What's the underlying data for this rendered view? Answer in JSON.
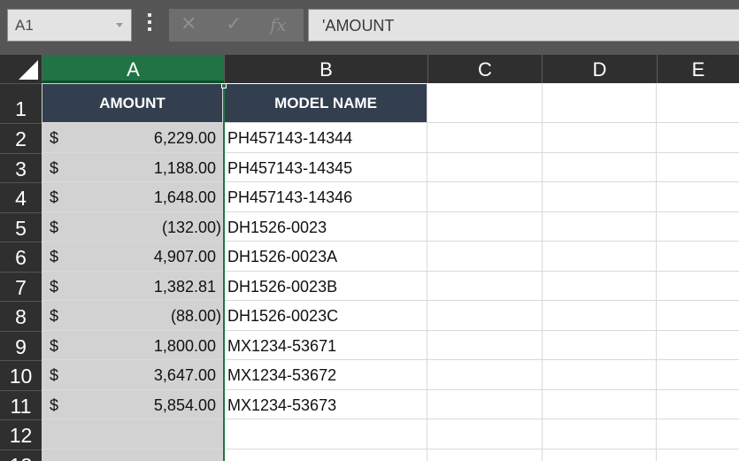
{
  "name_box": {
    "value": "A1"
  },
  "formula_bar": {
    "cancel_icon": "✕",
    "enter_icon": "✓",
    "fx_icon": "fx",
    "content": "'AMOUNT"
  },
  "columns": [
    "A",
    "B",
    "C",
    "D",
    "E"
  ],
  "rows": [
    "1",
    "2",
    "3",
    "4",
    "5",
    "6",
    "7",
    "8",
    "9",
    "10",
    "11",
    "12",
    "13"
  ],
  "table": {
    "headers": {
      "amount": "AMOUNT",
      "model": "MODEL NAME"
    },
    "currency_symbol": "$",
    "rows": [
      {
        "amount": "6,229.00",
        "model": "PH457143-14344"
      },
      {
        "amount": "1,188.00",
        "model": "PH457143-14345"
      },
      {
        "amount": "1,648.00",
        "model": "PH457143-14346"
      },
      {
        "amount": "(132.00)",
        "model": "DH1526-0023"
      },
      {
        "amount": "4,907.00",
        "model": "DH1526-0023A"
      },
      {
        "amount": "1,382.81",
        "model": "DH1526-0023B"
      },
      {
        "amount": "(88.00)",
        "model": "DH1526-0023C"
      },
      {
        "amount": "1,800.00",
        "model": "MX1234-53671"
      },
      {
        "amount": "3,647.00",
        "model": "MX1234-53672"
      },
      {
        "amount": "5,854.00",
        "model": "MX1234-53673"
      }
    ]
  },
  "colors": {
    "selected_column": "#217346",
    "header_fill": "#333f4f",
    "selected_cells": "#d2d2d2"
  }
}
